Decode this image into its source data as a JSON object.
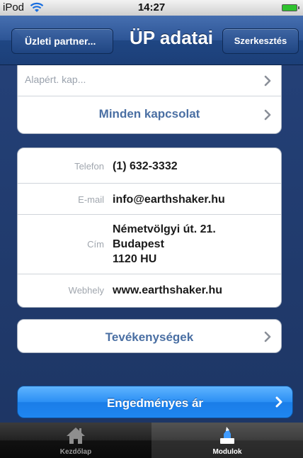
{
  "status_bar": {
    "carrier": "iPod",
    "time": "14:27"
  },
  "nav": {
    "back_label": "Üzleti partner...",
    "title": "ÜP adatai",
    "edit_label": "Szerkesztés"
  },
  "top_group": {
    "default_contact_label": "Alapért. kap...",
    "all_contacts_label": "Minden kapcsolat"
  },
  "contact": {
    "phone_key": "Telefon",
    "phone_value": "(1) 632-3332",
    "email_key": "E-mail",
    "email_value": "info@earthshaker.hu",
    "address_key": "Cím",
    "address_line1": "Németvölgyi út. 21.",
    "address_line2": "Budapest",
    "address_line3": "1120 HU",
    "website_key": "Webhely",
    "website_value": "www.earthshaker.hu"
  },
  "activities_label": "Tevékenységek",
  "discount_button_label": "Engedményes ár",
  "tab_bar": {
    "home_label": "Kezdőlap",
    "modules_label": "Modulok",
    "selected": "Modulok"
  },
  "colors": {
    "nav_blue": "#2d5596",
    "link_blue": "#4a6fa3",
    "primary_button": "#2b8ff4",
    "battery": "#2ec22e"
  },
  "icons": [
    "wifi-icon",
    "battery-icon",
    "chevron-right-icon",
    "home-icon",
    "modules-icon"
  ]
}
